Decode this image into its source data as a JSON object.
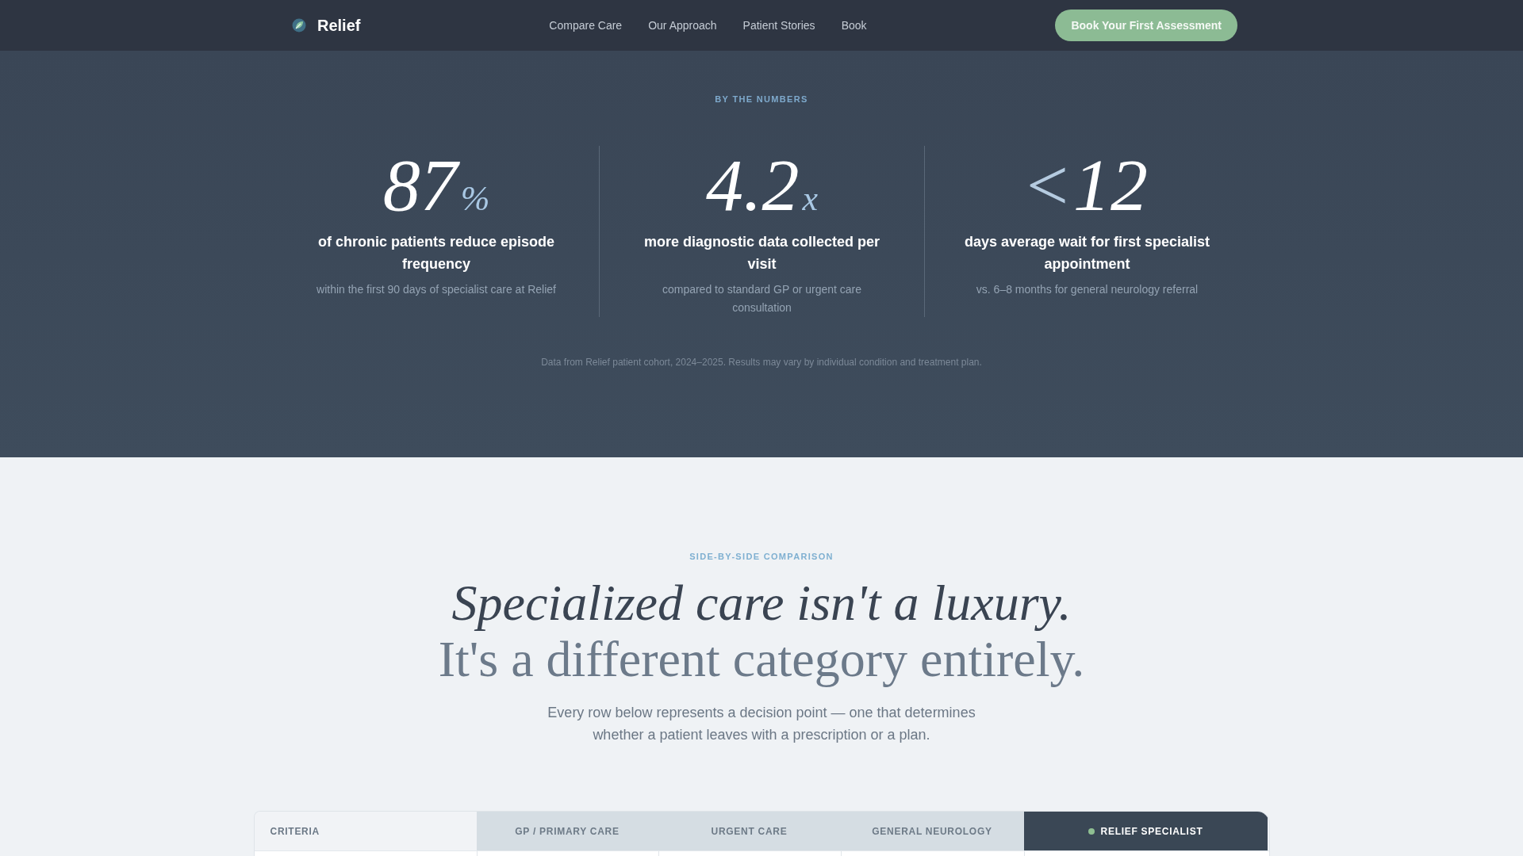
{
  "header": {
    "brand": "Relief",
    "nav_links": [
      {
        "label": "Compare Care"
      },
      {
        "label": "Our Approach"
      },
      {
        "label": "Patient Stories"
      },
      {
        "label": "Book"
      }
    ],
    "cta_button": "Book Your First Assessment"
  },
  "stats_section": {
    "eyebrow": "BY THE NUMBERS",
    "stats": [
      {
        "value": "87",
        "suffix": "%",
        "headline": "of chronic patients reduce episode frequency",
        "detail": "within the first 90 days of specialist care at Relief"
      },
      {
        "value": "4.2",
        "suffix": "x",
        "headline": "more diagnostic data collected per visit",
        "detail": "compared to standard GP or urgent care consultation"
      },
      {
        "prefix": "<",
        "value": "12",
        "headline": "days average wait for first specialist appointment",
        "detail": "vs. 6–8 months for general neurology referral"
      }
    ],
    "footnote": "Data from Relief patient cohort, 2024–2025. Results may vary by individual condition and treatment plan."
  },
  "comparison": {
    "eyebrow": "SIDE-BY-SIDE COMPARISON",
    "heading": "Specialized care isn't a luxury.",
    "subheading": "It's a different category entirely.",
    "intro": "Every row below represents a decision point — one that determines whether a patient leaves with a prescription or a plan.",
    "table": {
      "columns": [
        {
          "label": "CRITERIA",
          "kind": "criteria"
        },
        {
          "label": "GP / PRIMARY CARE",
          "kind": "alternative"
        },
        {
          "label": "URGENT CARE",
          "kind": "alternative"
        },
        {
          "label": "GENERAL NEUROLOGY",
          "kind": "alternative"
        },
        {
          "label": "RELIEF SPECIALIST",
          "kind": "featured"
        }
      ]
    }
  }
}
